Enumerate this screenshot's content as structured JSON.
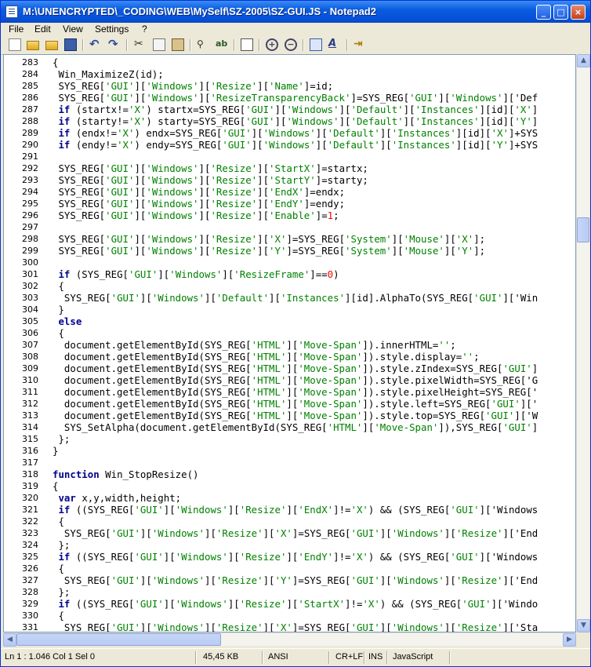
{
  "window": {
    "title": "M:\\UNENCRYPTED\\_CODING\\WEB\\MySelf\\SZ-2005\\SZ-GUI.JS - Notepad2",
    "minimize": "_",
    "maximize": "□",
    "close": "×"
  },
  "menu": [
    "File",
    "Edit",
    "View",
    "Settings",
    "?"
  ],
  "toolbar": {
    "icons": [
      "new-file-icon",
      "open-folder-icon",
      "browse-icon",
      "save-icon",
      "undo-icon",
      "redo-icon",
      "cut-icon",
      "copy-icon",
      "paste-icon",
      "find-icon",
      "replace-icon",
      "word-wrap-icon",
      "zoom-in-icon",
      "zoom-out-icon",
      "scheme-icon",
      "font-icon",
      "exit-icon"
    ]
  },
  "editor": {
    "lines": [
      {
        "n": "283",
        "code": "{"
      },
      {
        "n": "284",
        "code": " Win_MaximizeZ(id);"
      },
      {
        "n": "285",
        "code": " SYS_REG['GUI']['Windows']['Resize']['Name']=id;"
      },
      {
        "n": "286",
        "code": " SYS_REG['GUI']['Windows']['ResizeTransparencyBack']=SYS_REG['GUI']['Windows']['Def"
      },
      {
        "n": "287",
        "code": " if (startx!='X') startx=SYS_REG['GUI']['Windows']['Default']['Instances'][id]['X']"
      },
      {
        "n": "288",
        "code": " if (starty!='X') starty=SYS_REG['GUI']['Windows']['Default']['Instances'][id]['Y']"
      },
      {
        "n": "289",
        "code": " if (endx!='X') endx=SYS_REG['GUI']['Windows']['Default']['Instances'][id]['X']+SYS"
      },
      {
        "n": "290",
        "code": " if (endy!='X') endy=SYS_REG['GUI']['Windows']['Default']['Instances'][id]['Y']+SYS"
      },
      {
        "n": "291",
        "code": ""
      },
      {
        "n": "292",
        "code": " SYS_REG['GUI']['Windows']['Resize']['StartX']=startx;"
      },
      {
        "n": "293",
        "code": " SYS_REG['GUI']['Windows']['Resize']['StartY']=starty;"
      },
      {
        "n": "294",
        "code": " SYS_REG['GUI']['Windows']['Resize']['EndX']=endx;"
      },
      {
        "n": "295",
        "code": " SYS_REG['GUI']['Windows']['Resize']['EndY']=endy;"
      },
      {
        "n": "296",
        "code": " SYS_REG['GUI']['Windows']['Resize']['Enable']=1;"
      },
      {
        "n": "297",
        "code": ""
      },
      {
        "n": "298",
        "code": " SYS_REG['GUI']['Windows']['Resize']['X']=SYS_REG['System']['Mouse']['X'];"
      },
      {
        "n": "299",
        "code": " SYS_REG['GUI']['Windows']['Resize']['Y']=SYS_REG['System']['Mouse']['Y'];"
      },
      {
        "n": "300",
        "code": ""
      },
      {
        "n": "301",
        "code": " if (SYS_REG['GUI']['Windows']['ResizeFrame']==0)"
      },
      {
        "n": "302",
        "code": " {"
      },
      {
        "n": "303",
        "code": "  SYS_REG['GUI']['Windows']['Default']['Instances'][id].AlphaTo(SYS_REG['GUI']['Win"
      },
      {
        "n": "304",
        "code": " }"
      },
      {
        "n": "305",
        "code": " else"
      },
      {
        "n": "306",
        "code": " {"
      },
      {
        "n": "307",
        "code": "  document.getElementById(SYS_REG['HTML']['Move-Span']).innerHTML='';"
      },
      {
        "n": "308",
        "code": "  document.getElementById(SYS_REG['HTML']['Move-Span']).style.display='';"
      },
      {
        "n": "309",
        "code": "  document.getElementById(SYS_REG['HTML']['Move-Span']).style.zIndex=SYS_REG['GUI']"
      },
      {
        "n": "310",
        "code": "  document.getElementById(SYS_REG['HTML']['Move-Span']).style.pixelWidth=SYS_REG['G"
      },
      {
        "n": "311",
        "code": "  document.getElementById(SYS_REG['HTML']['Move-Span']).style.pixelHeight=SYS_REG['"
      },
      {
        "n": "312",
        "code": "  document.getElementById(SYS_REG['HTML']['Move-Span']).style.left=SYS_REG['GUI']['"
      },
      {
        "n": "313",
        "code": "  document.getElementById(SYS_REG['HTML']['Move-Span']).style.top=SYS_REG['GUI']['W"
      },
      {
        "n": "314",
        "code": "  SYS_SetAlpha(document.getElementById(SYS_REG['HTML']['Move-Span']),SYS_REG['GUI']"
      },
      {
        "n": "315",
        "code": " };"
      },
      {
        "n": "316",
        "code": "}"
      },
      {
        "n": "317",
        "code": ""
      },
      {
        "n": "318",
        "code": "function Win_StopResize()"
      },
      {
        "n": "319",
        "code": "{"
      },
      {
        "n": "320",
        "code": " var x,y,width,height;"
      },
      {
        "n": "321",
        "code": " if ((SYS_REG['GUI']['Windows']['Resize']['EndX']!='X') && (SYS_REG['GUI']['Windows"
      },
      {
        "n": "322",
        "code": " {"
      },
      {
        "n": "323",
        "code": "  SYS_REG['GUI']['Windows']['Resize']['X']=SYS_REG['GUI']['Windows']['Resize']['End"
      },
      {
        "n": "324",
        "code": " };"
      },
      {
        "n": "325",
        "code": " if ((SYS_REG['GUI']['Windows']['Resize']['EndY']!='X') && (SYS_REG['GUI']['Windows"
      },
      {
        "n": "326",
        "code": " {"
      },
      {
        "n": "327",
        "code": "  SYS_REG['GUI']['Windows']['Resize']['Y']=SYS_REG['GUI']['Windows']['Resize']['End"
      },
      {
        "n": "328",
        "code": " };"
      },
      {
        "n": "329",
        "code": " if ((SYS_REG['GUI']['Windows']['Resize']['StartX']!='X') && (SYS_REG['GUI']['Windo"
      },
      {
        "n": "330",
        "code": " {"
      },
      {
        "n": "331",
        "code": "  SYS_REG['GUI']['Windows']['Resize']['X']=SYS_REG['GUI']['Windows']['Resize']['Sta"
      }
    ]
  },
  "status": {
    "position": "Ln 1 : 1.046   Col 1   Sel 0",
    "size": "45,45 KB",
    "encoding": "ANSI",
    "line_endings": "CR+LF",
    "mode": "INS",
    "language": "JavaScript"
  },
  "colors": {
    "string": "#008000",
    "keyword": "#00008b",
    "number": "#ff0000",
    "title_bar": "#0a5ce0"
  }
}
